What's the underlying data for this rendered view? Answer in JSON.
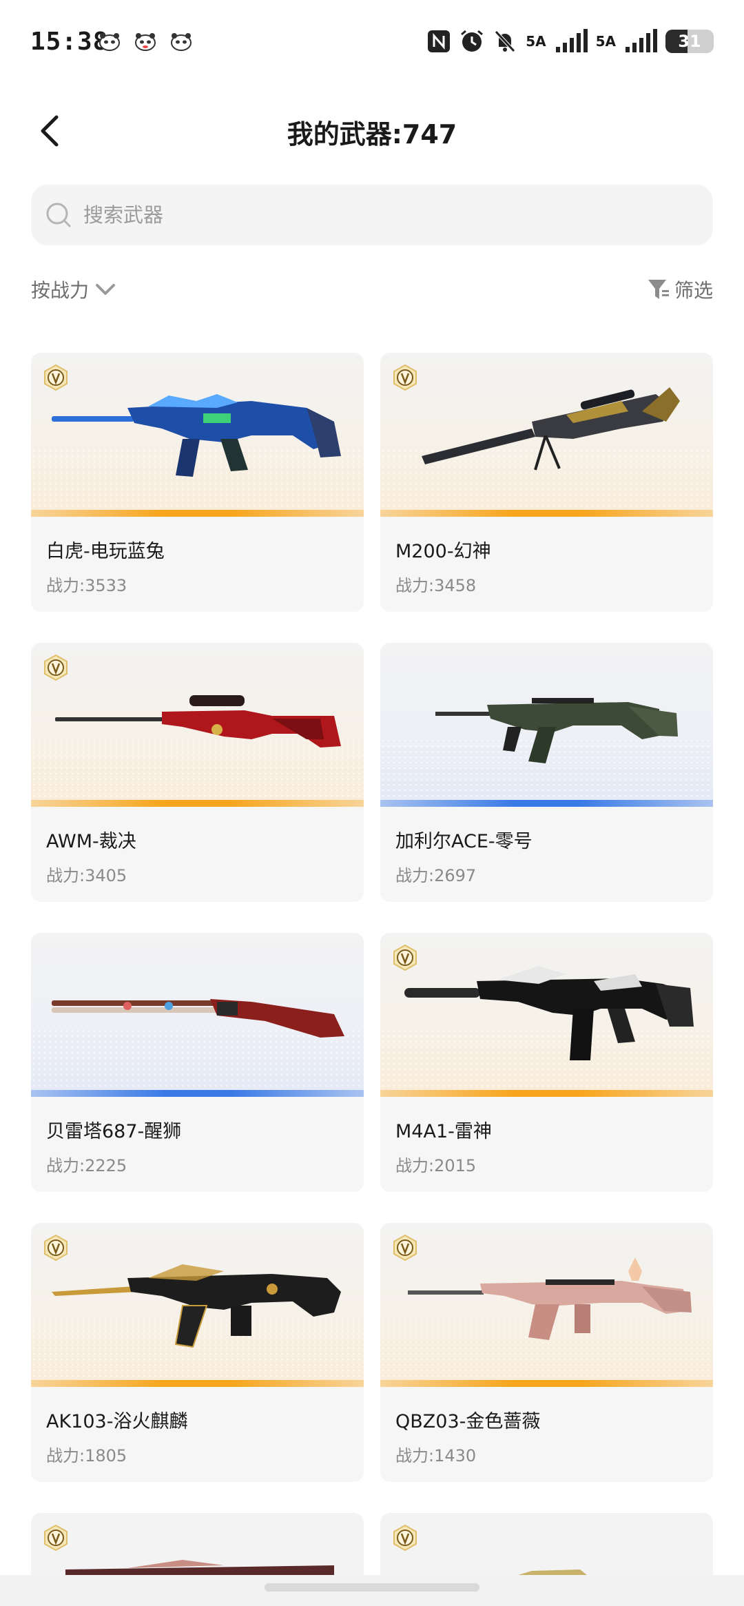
{
  "status_bar": {
    "time": "15:38",
    "net1": "5A",
    "net2": "5A",
    "battery": "31",
    "icons": [
      "panda-icon",
      "panda-icon",
      "panda-icon",
      "nfc-icon",
      "alarm-icon",
      "mute-icon",
      "signal-icon",
      "signal-icon"
    ]
  },
  "header": {
    "title": "我的武器:747",
    "back_icon": "chevron-left-icon"
  },
  "search": {
    "placeholder": "搜索武器",
    "value": ""
  },
  "sort": {
    "label": "按战力",
    "icon": "chevron-down-icon"
  },
  "filter": {
    "label": "筛选",
    "icon": "funnel-icon"
  },
  "weapons": [
    {
      "name": "白虎-电玩蓝兔",
      "power": "战力:3533",
      "tier": "gold",
      "badge": "V"
    },
    {
      "name": "M200-幻神",
      "power": "战力:3458",
      "tier": "gold",
      "badge": "V"
    },
    {
      "name": "AWM-裁决",
      "power": "战力:3405",
      "tier": "gold",
      "badge": "V"
    },
    {
      "name": "加利尔ACE-零号",
      "power": "战力:2697",
      "tier": "blue",
      "badge": ""
    },
    {
      "name": "贝雷塔687-醒狮",
      "power": "战力:2225",
      "tier": "blue",
      "badge": ""
    },
    {
      "name": "M4A1-雷神",
      "power": "战力:2015",
      "tier": "gold",
      "badge": "V"
    },
    {
      "name": "AK103-浴火麒麟",
      "power": "战力:1805",
      "tier": "gold",
      "badge": "V"
    },
    {
      "name": "QBZ03-金色蔷薇",
      "power": "战力:1430",
      "tier": "gold",
      "badge": "V"
    }
  ],
  "colors": {
    "gold": "#f7a51c",
    "blue": "#3a7ae6",
    "card_bg": "#f6f6f6",
    "search_bg": "#f4f4f4"
  }
}
